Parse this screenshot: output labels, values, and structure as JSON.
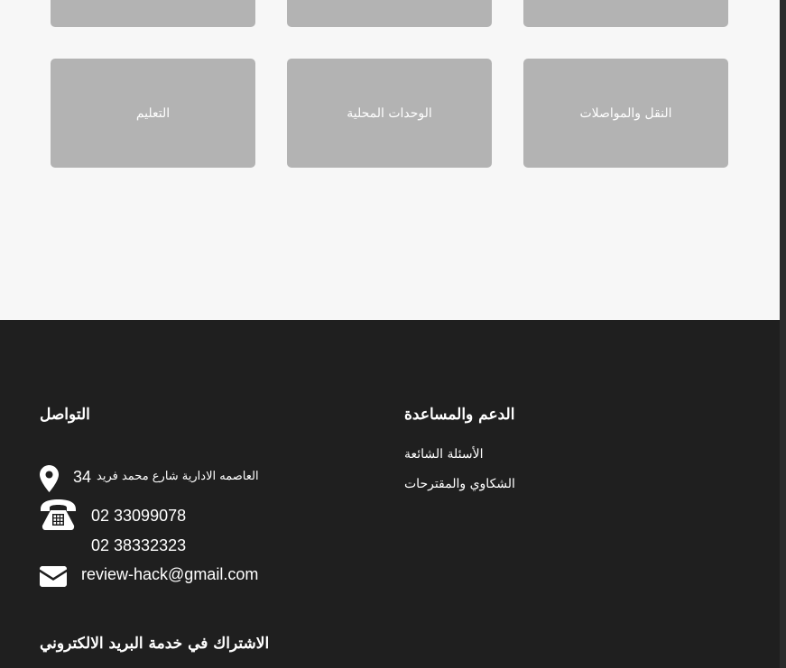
{
  "categories": {
    "top_row": [
      "",
      "",
      ""
    ],
    "bottom_row": [
      "التعليم",
      "الوحدات المحلية",
      "النقل والمواصلات"
    ]
  },
  "footer": {
    "contact": {
      "heading": "التواصل",
      "address_number": "34",
      "address_text": "العاصمه الادارية شارع محمد فريد",
      "phone_1": "02 33099078",
      "phone_2": "02 38332323",
      "email": "review-hack@gmail.com",
      "icons": [
        "location-pin-icon",
        "telephone-icon",
        "envelope-icon"
      ]
    },
    "support": {
      "heading": "الدعم والمساعدة",
      "links": [
        "الأسئلة الشائعة",
        "الشكاوي والمقترحات"
      ]
    },
    "newsletter": {
      "heading": "الاشتراك في خدمة البريد الالكتروني"
    }
  },
  "colors": {
    "page_bg": "#f7f7f7",
    "tile_bg": "#b3b3b3",
    "footer_bg": "#1f1f1f",
    "text_light": "#ffffff"
  }
}
